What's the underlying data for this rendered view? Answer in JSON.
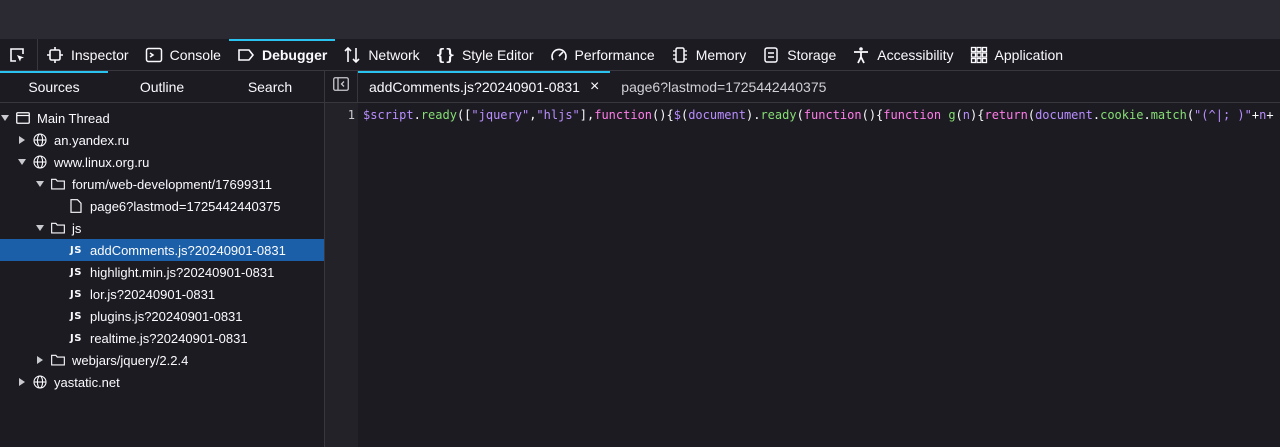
{
  "colors": {
    "accent": "#2ac3f0",
    "selected": "#1b5fa8",
    "keyword": "#ff7de9",
    "string": "#86de74",
    "identifier": "#b98eff",
    "plain": "#fbfbfe"
  },
  "toolbar": {
    "tools": [
      {
        "label": "Inspector",
        "icon": "inspector-icon"
      },
      {
        "label": "Console",
        "icon": "console-icon"
      },
      {
        "label": "Debugger",
        "icon": "debugger-icon"
      },
      {
        "label": "Network",
        "icon": "network-icon"
      },
      {
        "label": "Style Editor",
        "icon": "style-editor-icon"
      },
      {
        "label": "Performance",
        "icon": "performance-icon"
      },
      {
        "label": "Memory",
        "icon": "memory-icon"
      },
      {
        "label": "Storage",
        "icon": "storage-icon"
      },
      {
        "label": "Accessibility",
        "icon": "accessibility-icon"
      },
      {
        "label": "Application",
        "icon": "application-icon"
      }
    ],
    "active": "Debugger"
  },
  "left_tabs": [
    "Sources",
    "Outline",
    "Search"
  ],
  "tree": [
    {
      "label": "Main Thread",
      "icon": "window-icon",
      "expanded": true
    },
    {
      "label": "an.yandex.ru",
      "icon": "globe-icon",
      "expanded": false
    },
    {
      "label": "www.linux.org.ru",
      "icon": "globe-icon",
      "expanded": true
    },
    {
      "label": "forum/web-development/17699311",
      "icon": "folder-icon",
      "expanded": true
    },
    {
      "label": "page6?lastmod=1725442440375",
      "icon": "file-icon"
    },
    {
      "label": "js",
      "icon": "folder-icon",
      "expanded": true
    },
    {
      "label": "addComments.js?20240901-0831",
      "icon": "js-icon",
      "badge": "JS",
      "selected": true
    },
    {
      "label": "highlight.min.js?20240901-0831",
      "icon": "js-icon",
      "badge": "JS"
    },
    {
      "label": "lor.js?20240901-0831",
      "icon": "js-icon",
      "badge": "JS"
    },
    {
      "label": "plugins.js?20240901-0831",
      "icon": "js-icon",
      "badge": "JS"
    },
    {
      "label": "realtime.js?20240901-0831",
      "icon": "js-icon",
      "badge": "JS"
    },
    {
      "label": "webjars/jquery/2.2.4",
      "icon": "folder-icon",
      "expanded": false
    },
    {
      "label": "yastatic.net",
      "icon": "globe-icon",
      "expanded": false
    }
  ],
  "editor": {
    "tabs": [
      {
        "label": "addComments.js?20240901-0831",
        "active": true,
        "close": "×"
      },
      {
        "label": "page6?lastmod=1725442440375",
        "active": false
      }
    ],
    "line_number": "1",
    "code_tokens": [
      {
        "t": "$script",
        "c": "identifier"
      },
      {
        "t": ".",
        "c": "plain"
      },
      {
        "t": "ready",
        "c": "string"
      },
      {
        "t": "([",
        "c": "plain"
      },
      {
        "t": "\"jquery\"",
        "c": "identifier"
      },
      {
        "t": ",",
        "c": "plain"
      },
      {
        "t": "\"hljs\"",
        "c": "identifier"
      },
      {
        "t": "],",
        "c": "plain"
      },
      {
        "t": "function",
        "c": "keyword"
      },
      {
        "t": "(){",
        "c": "plain"
      },
      {
        "t": "$",
        "c": "identifier"
      },
      {
        "t": "(",
        "c": "plain"
      },
      {
        "t": "document",
        "c": "identifier"
      },
      {
        "t": ").",
        "c": "plain"
      },
      {
        "t": "ready",
        "c": "string"
      },
      {
        "t": "(",
        "c": "plain"
      },
      {
        "t": "function",
        "c": "keyword"
      },
      {
        "t": "(){",
        "c": "plain"
      },
      {
        "t": "function",
        "c": "keyword"
      },
      {
        "t": " ",
        "c": "plain"
      },
      {
        "t": "g",
        "c": "string"
      },
      {
        "t": "(",
        "c": "plain"
      },
      {
        "t": "n",
        "c": "identifier"
      },
      {
        "t": "){",
        "c": "plain"
      },
      {
        "t": "return",
        "c": "keyword"
      },
      {
        "t": "(",
        "c": "plain"
      },
      {
        "t": "document",
        "c": "identifier"
      },
      {
        "t": ".",
        "c": "plain"
      },
      {
        "t": "cookie",
        "c": "string"
      },
      {
        "t": ".",
        "c": "plain"
      },
      {
        "t": "match",
        "c": "string"
      },
      {
        "t": "(",
        "c": "plain"
      },
      {
        "t": "\"(^|; )\"",
        "c": "identifier"
      },
      {
        "t": "+",
        "c": "plain"
      },
      {
        "t": "n",
        "c": "identifier"
      },
      {
        "t": "+",
        "c": "plain"
      }
    ]
  }
}
